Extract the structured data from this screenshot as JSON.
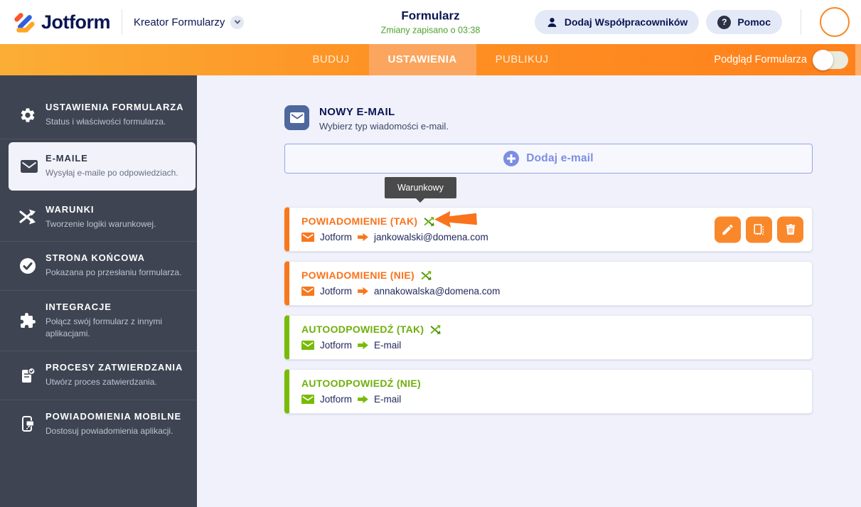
{
  "header": {
    "logo_text": "Jotform",
    "builder_label": "Kreator Formularzy",
    "title": "Formularz",
    "autosave_status": "Zmiany zapisano o 03:38",
    "add_collaborators_label": "Dodaj Współpracowników",
    "help_label": "Pomoc"
  },
  "nav": {
    "tabs": [
      {
        "label": "BUDUJ",
        "active": false
      },
      {
        "label": "USTAWIENIA",
        "active": true
      },
      {
        "label": "PUBLIKUJ",
        "active": false
      }
    ],
    "preview_label": "Podgląd Formularza",
    "preview_on": false
  },
  "sidebar": {
    "items": [
      {
        "label": "USTAWIENIA FORMULARZA",
        "description": "Status i właściwości formularza.",
        "icon": "gear-icon",
        "active": false
      },
      {
        "label": "E-MAILE",
        "description": "Wysyłaj e-maile po odpowiedziach.",
        "icon": "envelope-icon",
        "active": true
      },
      {
        "label": "WARUNKI",
        "description": "Tworzenie logiki warunkowej.",
        "icon": "shuffle-icon",
        "active": false
      },
      {
        "label": "STRONA KOŃCOWA",
        "description": "Pokazana po przesłaniu formularza.",
        "icon": "check-circle-icon",
        "active": false
      },
      {
        "label": "INTEGRACJE",
        "description": "Połącz swój formularz z innymi aplikacjami.",
        "icon": "puzzle-icon",
        "active": false
      },
      {
        "label": "PROCESY ZATWIERDZANIA",
        "description": "Utwórz proces zatwierdzania.",
        "icon": "approval-doc-icon",
        "active": false
      },
      {
        "label": "POWIADOMIENIA MOBILNE",
        "description": "Dostosuj powiadomienia aplikacji.",
        "icon": "mobile-phone-icon",
        "active": false
      }
    ]
  },
  "main": {
    "section_title": "NOWY E-MAIL",
    "section_subtitle": "Wybierz typ wiadomości e-mail.",
    "add_email_label": "Dodaj e-mail",
    "tooltip": "Warunkowy",
    "emails": [
      {
        "title": "POWIADOMIENIE (TAK)",
        "sender": "Jotform",
        "recipient": "jankowalski@domena.com",
        "color": "orange",
        "conditional": true,
        "actions": [
          "edit",
          "duplicate",
          "delete"
        ]
      },
      {
        "title": "POWIADOMIENIE (NIE)",
        "sender": "Jotform",
        "recipient": "annakowalska@domena.com",
        "color": "orange",
        "conditional": true
      },
      {
        "title": "AUTOODPOWIEDŹ (TAK)",
        "sender": "Jotform",
        "recipient": "E-mail",
        "color": "green",
        "conditional": true
      },
      {
        "title": "AUTOODPOWIEDŹ (NIE)",
        "sender": "Jotform",
        "recipient": "E-mail",
        "color": "green",
        "conditional": false
      }
    ]
  },
  "colors": {
    "brand_navy": "#0A1551",
    "nav_orange": "#FF811C",
    "accent_orange": "#F9771D",
    "accent_green": "#78BB07",
    "autosave_green": "#4DA22C",
    "add_email_blue": "#7C8EE1",
    "sidebar_dark": "#3E4452"
  }
}
